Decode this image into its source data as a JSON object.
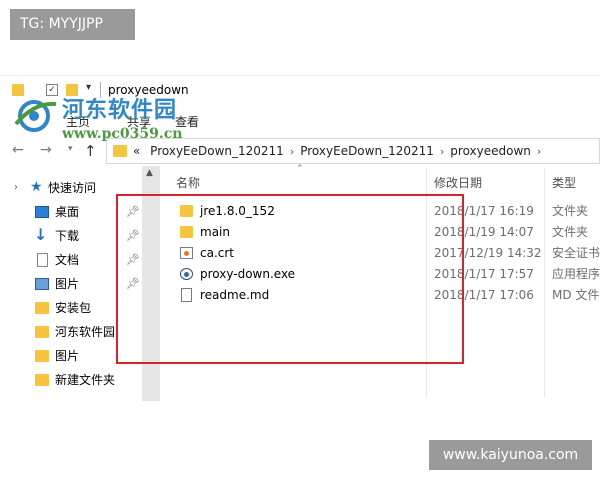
{
  "overlay": {
    "tg_label": "TG: MYYJJPP",
    "site_label": "www.kaiyunoa.com"
  },
  "watermark": {
    "name": "河东软件园",
    "url": "www.pc0359.cn"
  },
  "window": {
    "title": "proxyeedown"
  },
  "ribbon": {
    "tabs": [
      "主页",
      "共享",
      "查看"
    ]
  },
  "address_bar": {
    "prefix": "«",
    "crumbs": [
      "ProxyEeDown_120211",
      "ProxyEeDown_120211",
      "proxyeedown"
    ],
    "separator": "›"
  },
  "sidebar": {
    "quick_access_label": "快速访问",
    "items": [
      {
        "label": "桌面",
        "icon": "desktop-icon",
        "pinned": true
      },
      {
        "label": "下载",
        "icon": "download-icon",
        "pinned": true
      },
      {
        "label": "文档",
        "icon": "document-icon",
        "pinned": true
      },
      {
        "label": "图片",
        "icon": "picture-icon",
        "pinned": true
      },
      {
        "label": "安装包",
        "icon": "folder-icon",
        "pinned": false
      },
      {
        "label": "河东软件园",
        "icon": "folder-icon",
        "pinned": false
      },
      {
        "label": "图片",
        "icon": "folder-icon",
        "pinned": false
      },
      {
        "label": "新建文件夹",
        "icon": "folder-icon",
        "pinned": false
      }
    ]
  },
  "file_list": {
    "columns": {
      "name": "名称",
      "date": "修改日期",
      "type": "类型"
    },
    "rows": [
      {
        "name": "jre1.8.0_152",
        "date": "2018/1/17 16:19",
        "type": "文件夹",
        "icon": "folder-icon"
      },
      {
        "name": "main",
        "date": "2018/1/19 14:07",
        "type": "文件夹",
        "icon": "folder-icon"
      },
      {
        "name": "ca.crt",
        "date": "2017/12/19 14:32",
        "type": "安全证书",
        "icon": "certificate-icon"
      },
      {
        "name": "proxy-down.exe",
        "date": "2018/1/17 17:57",
        "type": "应用程序",
        "icon": "exe-icon"
      },
      {
        "name": "readme.md",
        "date": "2018/1/17 17:06",
        "type": "MD 文件",
        "icon": "text-file-icon"
      }
    ]
  },
  "colors": {
    "highlight_box": "#d8232a",
    "folder": "#f5c542",
    "watermark_blue": "#2f87c8",
    "watermark_green": "#4d9a3a"
  }
}
